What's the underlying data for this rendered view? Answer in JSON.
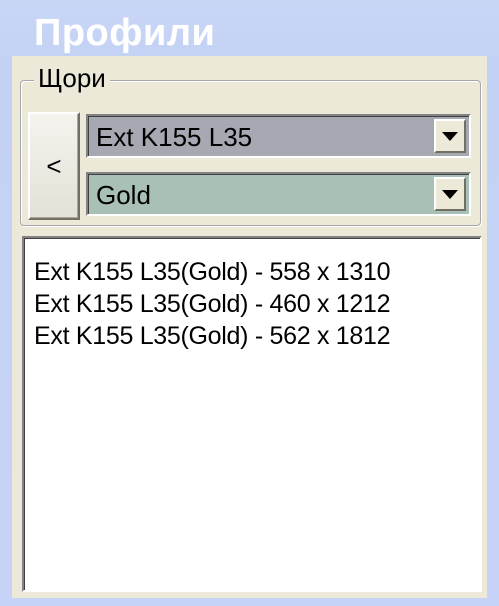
{
  "panel": {
    "title": "Профили"
  },
  "group": {
    "label": "Щори"
  },
  "back_button": {
    "label": "<"
  },
  "profile_select": {
    "value": "Ext K155 L35"
  },
  "color_select": {
    "value": "Gold"
  },
  "list": {
    "items": [
      "Ext K155 L35(Gold) - 558 x 1310",
      "Ext K155 L35(Gold) - 460 x 1212",
      "Ext K155 L35(Gold) - 562 x 1812"
    ]
  }
}
